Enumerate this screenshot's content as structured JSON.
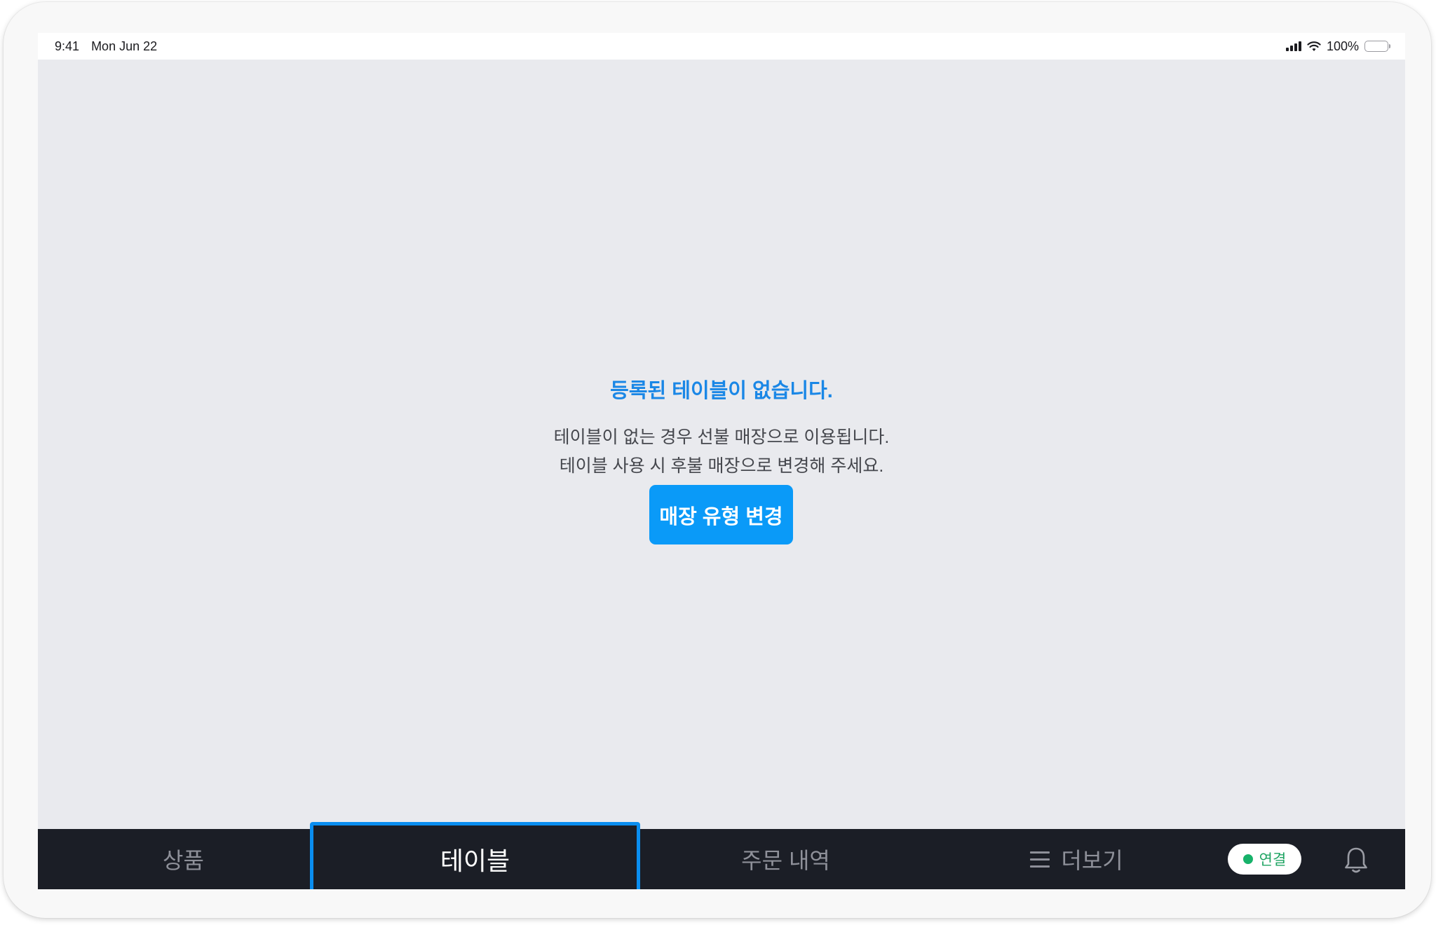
{
  "status_bar": {
    "time": "9:41",
    "date": "Mon Jun 22",
    "battery": "100%"
  },
  "empty_state": {
    "title": "등록된 테이블이 없습니다.",
    "description_line1": "테이블이 없는 경우 선불 매장으로 이용됩니다.",
    "description_line2": "테이블 사용 시 후불 매장으로 변경해 주세요.",
    "button_label": "매장 유형 변경"
  },
  "bottom_nav": {
    "tabs": [
      {
        "label": "상품",
        "selected": false
      },
      {
        "label": "테이블",
        "selected": true
      },
      {
        "label": "주문 내역",
        "selected": false
      },
      {
        "label": "더보기",
        "selected": false,
        "icon": "menu-icon"
      }
    ],
    "connection_status": "연결",
    "notification_icon": "bell-icon"
  },
  "colors": {
    "accent": "#0a9af8",
    "title": "#1a87e6",
    "nav_background": "#1b1e26",
    "selected_border": "#0a8ef0",
    "connected": "#17b26a",
    "screen_background": "#e9eaee"
  }
}
